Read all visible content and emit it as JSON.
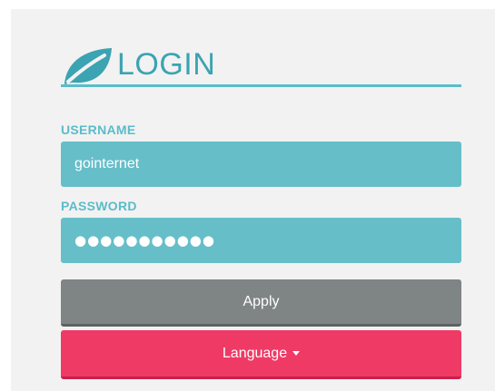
{
  "login": {
    "title": "LOGIN",
    "logo_icon": "leaf-icon",
    "accent_color": "#3ba3b2"
  },
  "username": {
    "label": "USERNAME",
    "value": "gointernet"
  },
  "password": {
    "label": "PASSWORD",
    "masked_value": "●●●●●●●●●●●"
  },
  "buttons": {
    "apply_label": "Apply",
    "language_label": "Language",
    "apply_color": "#7f8584",
    "language_color": "#ef3a66"
  }
}
